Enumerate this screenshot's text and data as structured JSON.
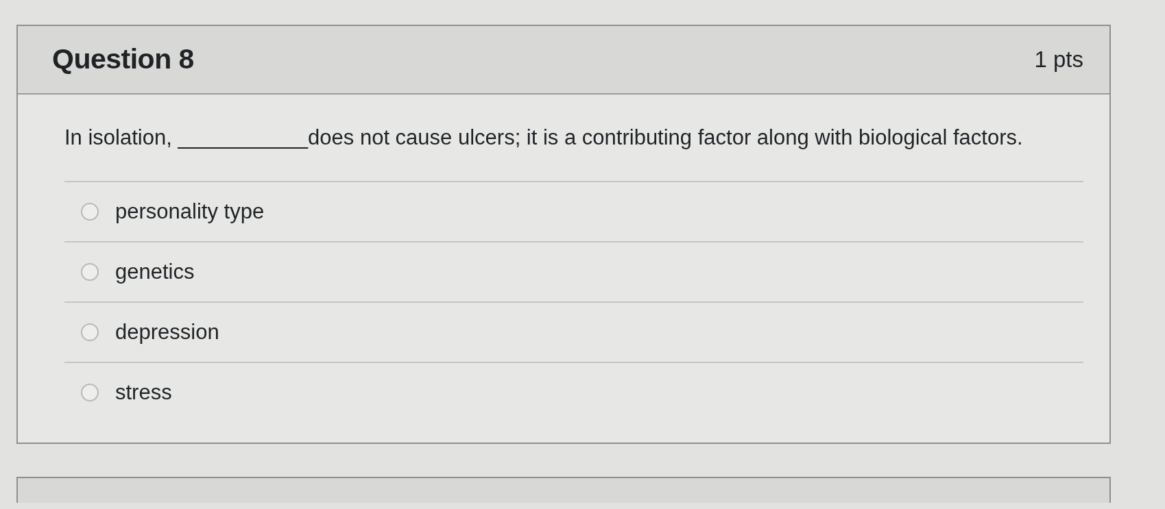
{
  "question": {
    "title": "Question 8",
    "points": "1 pts",
    "text": "In isolation, ___________does not cause ulcers; it is a contributing factor along with biological factors."
  },
  "answers": [
    {
      "label": "personality type",
      "selected": false
    },
    {
      "label": "genetics",
      "selected": false
    },
    {
      "label": "depression",
      "selected": false
    },
    {
      "label": "stress",
      "selected": false
    }
  ]
}
